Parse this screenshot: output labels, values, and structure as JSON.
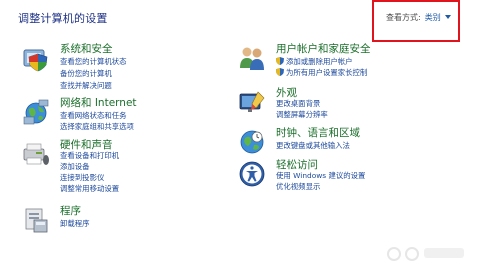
{
  "header": {
    "title": "调整计算机的设置",
    "view_label": "查看方式:",
    "view_value": "类别"
  },
  "left": [
    {
      "title": "系统和安全",
      "links": [
        "查看您的计算机状态",
        "备份您的计算机",
        "查找并解决问题"
      ]
    },
    {
      "title": "网络和 Internet",
      "links": [
        "查看网络状态和任务",
        "选择家庭组和共享选项"
      ]
    },
    {
      "title": "硬件和声音",
      "links": [
        "查看设备和打印机",
        "添加设备",
        "连接到投影仪",
        "调整常用移动设置"
      ]
    },
    {
      "title": "程序",
      "links": [
        "卸载程序"
      ]
    }
  ],
  "right": [
    {
      "title": "用户帐户和家庭安全",
      "links": [
        "添加或删除用户帐户",
        "为所有用户设置家长控制"
      ]
    },
    {
      "title": "外观",
      "links": [
        "更改桌面背景",
        "调整屏幕分辨率"
      ]
    },
    {
      "title": "时钟、语言和区域",
      "links": [
        "更改键盘或其他输入法"
      ]
    },
    {
      "title": "轻松访问",
      "links": [
        "使用 Windows 建议的设置",
        "优化视频显示"
      ]
    }
  ],
  "icons": {
    "system": "system-security-icon",
    "network": "network-internet-icon",
    "hardware": "hardware-sound-icon",
    "programs": "programs-icon",
    "users": "user-accounts-icon",
    "appearance": "appearance-icon",
    "clock": "clock-language-icon",
    "access": "ease-of-access-icon",
    "shield": "uac-shield-icon"
  },
  "colors": {
    "title": "#1e3287",
    "category": "#1b6f2b",
    "link": "#1e4a9c",
    "highlight": "#e0141c"
  }
}
